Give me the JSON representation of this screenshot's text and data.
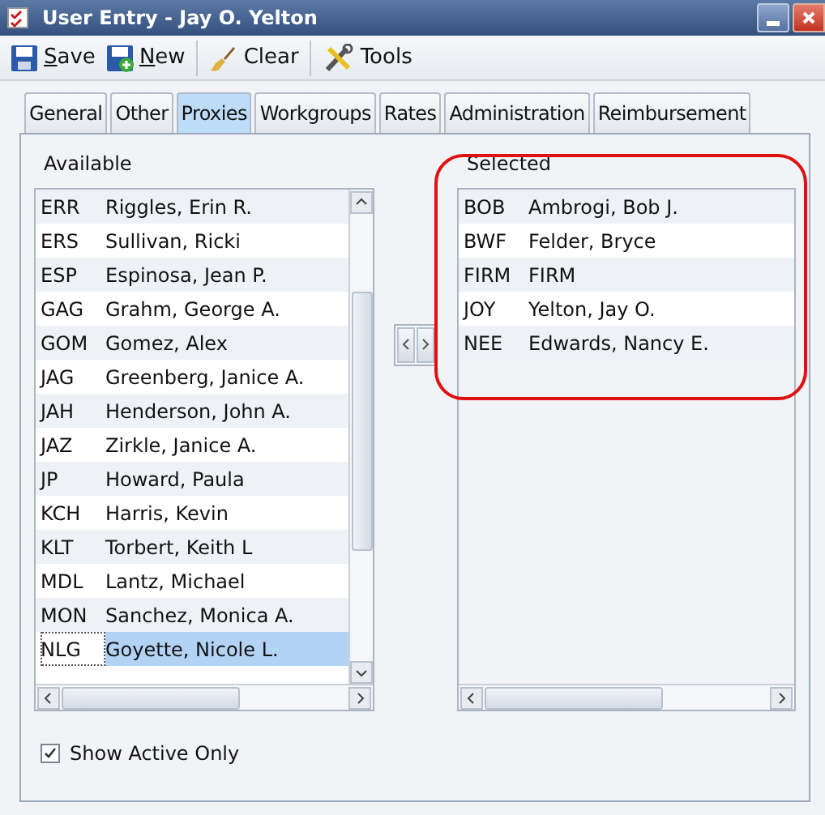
{
  "window": {
    "title": "User Entry - Jay O. Yelton"
  },
  "toolbar": [
    {
      "kind": "save",
      "label": "Save",
      "mnemonic_first": true
    },
    {
      "kind": "new",
      "label": "New",
      "mnemonic_first": true
    },
    {
      "kind": "clear",
      "label": "Clear",
      "mnemonic_first": false
    },
    {
      "kind": "tools",
      "label": "Tools",
      "mnemonic_first": false
    }
  ],
  "tabs": [
    {
      "label": "General",
      "selected": false
    },
    {
      "label": "Other",
      "selected": false
    },
    {
      "label": "Proxies",
      "selected": true
    },
    {
      "label": "Workgroups",
      "selected": false
    },
    {
      "label": "Rates",
      "selected": false
    },
    {
      "label": "Administration",
      "selected": false
    },
    {
      "label": "Reimbursement",
      "selected": false
    }
  ],
  "available": {
    "label": "Available",
    "items": [
      {
        "code": "ERR",
        "name": "Riggles, Erin R.",
        "selected": false
      },
      {
        "code": "ERS",
        "name": "Sullivan, Ricki",
        "selected": false
      },
      {
        "code": "ESP",
        "name": "Espinosa, Jean P.",
        "selected": false
      },
      {
        "code": "GAG",
        "name": "Grahm, George A.",
        "selected": false
      },
      {
        "code": "GOM",
        "name": "Gomez, Alex",
        "selected": false
      },
      {
        "code": "JAG",
        "name": "Greenberg, Janice A.",
        "selected": false
      },
      {
        "code": "JAH",
        "name": "Henderson, John A.",
        "selected": false
      },
      {
        "code": "JAZ",
        "name": "Zirkle, Janice A.",
        "selected": false
      },
      {
        "code": "JP",
        "name": "Howard, Paula",
        "selected": false
      },
      {
        "code": "KCH",
        "name": "Harris, Kevin",
        "selected": false
      },
      {
        "code": "KLT",
        "name": "Torbert, Keith L",
        "selected": false
      },
      {
        "code": "MDL",
        "name": "Lantz, Michael",
        "selected": false
      },
      {
        "code": "MON",
        "name": "Sanchez, Monica A.",
        "selected": false
      },
      {
        "code": "NLG",
        "name": "Goyette, Nicole L.",
        "selected": true
      }
    ]
  },
  "selected": {
    "label": "Selected",
    "items": [
      {
        "code": "BOB",
        "name": "Ambrogi, Bob J."
      },
      {
        "code": "BWF",
        "name": "Felder, Bryce"
      },
      {
        "code": "FIRM",
        "name": "FIRM"
      },
      {
        "code": "JOY",
        "name": "Yelton, Jay O."
      },
      {
        "code": "NEE",
        "name": "Edwards, Nancy E."
      }
    ]
  },
  "show_active_only": {
    "label": "Show Active Only",
    "checked": true
  }
}
